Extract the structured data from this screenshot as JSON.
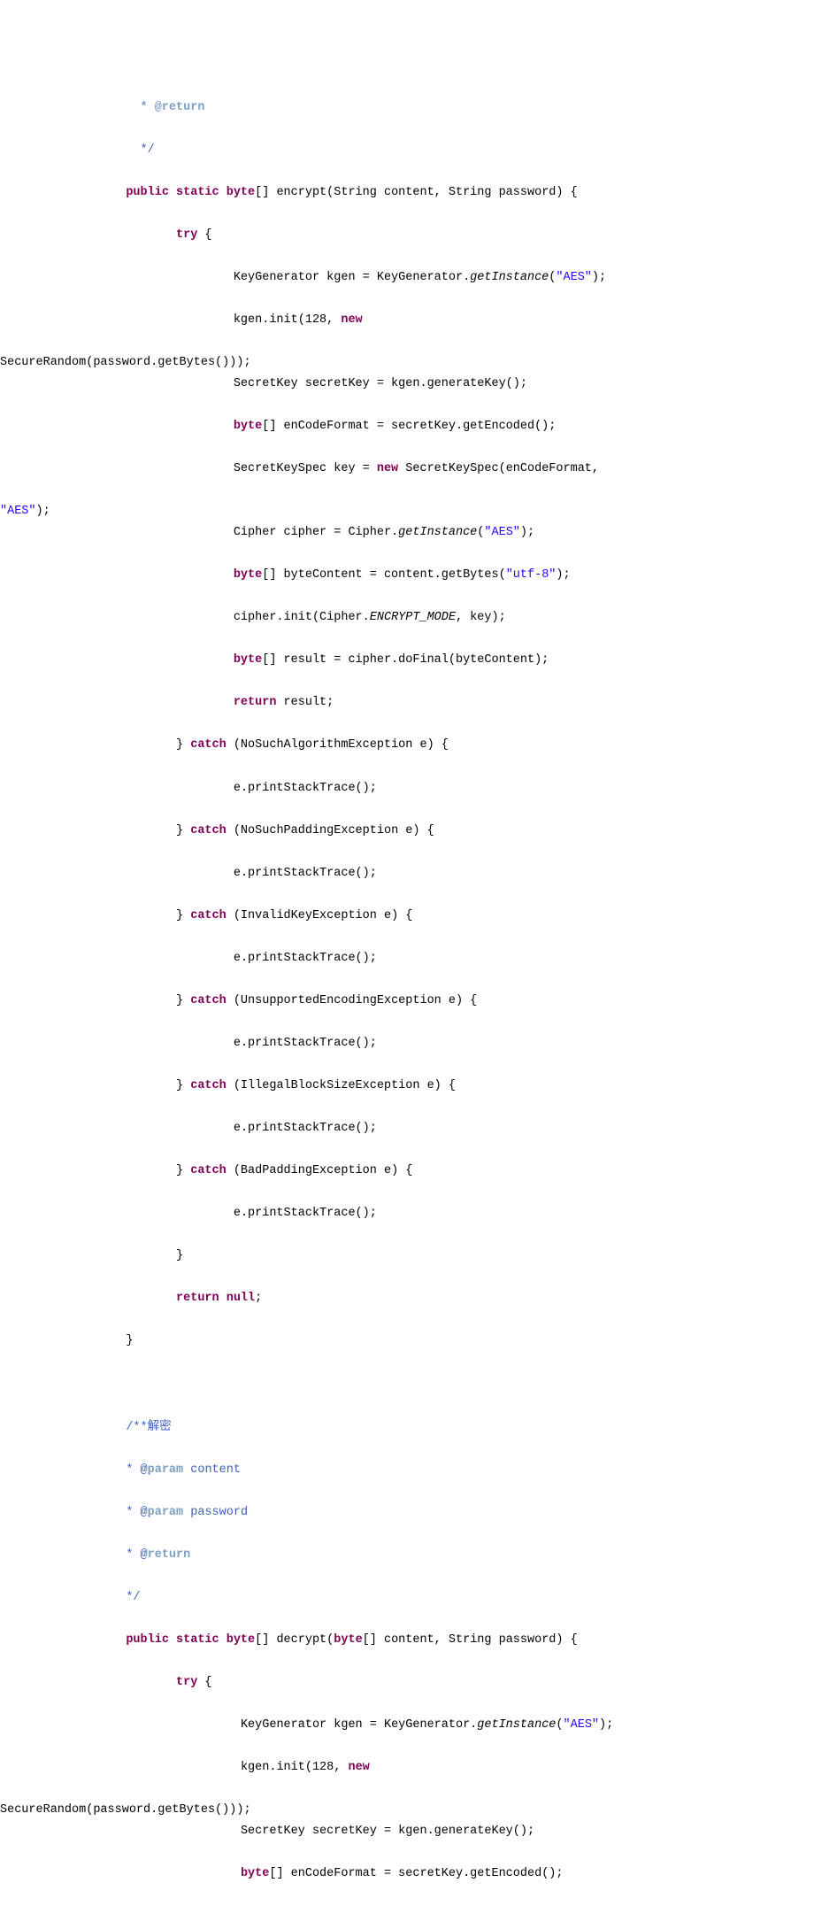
{
  "lines": {
    "l01": " * @return",
    "l02": " */",
    "l03_a": "public static byte",
    "l03_b": "[] encrypt(String content, String password) {",
    "l04": "try",
    "l04_b": " {",
    "l05_a": "KeyGenerator kgen = KeyGenerator.",
    "l05_b": "getInstance",
    "l05_c": "(",
    "l05_d": "\"AES\"",
    "l05_e": ");",
    "l06_a": "kgen.init(128, ",
    "l06_b": "new",
    "l07": "SecureRandom(password.getBytes()));",
    "l08": "SecretKey secretKey = kgen.generateKey();",
    "l09_a": "byte",
    "l09_b": "[] enCodeFormat = secretKey.getEncoded();",
    "l10_a": "SecretKeySpec key = ",
    "l10_b": "new",
    "l10_c": " SecretKeySpec(enCodeFormat, ",
    "l11": "\"AES\"",
    "l11_b": ");",
    "l12_a": "Cipher cipher = Cipher.",
    "l12_b": "getInstance",
    "l12_c": "(",
    "l12_d": "\"AES\"",
    "l12_e": ");",
    "l13_a": "byte",
    "l13_b": "[] byteContent = content.getBytes(",
    "l13_c": "\"utf-8\"",
    "l13_d": ");",
    "l14_a": "cipher.init(Cipher.",
    "l14_b": "ENCRYPT_MODE",
    "l14_c": ", key);",
    "l15_a": "byte",
    "l15_b": "[] result = cipher.doFinal(byteContent);",
    "l16_a": "return",
    "l16_b": " result;",
    "l17_a": "} ",
    "l17_b": "catch",
    "l17_c": " (NoSuchAlgorithmException e) {",
    "l18": "e.printStackTrace();",
    "l19_a": "} ",
    "l19_b": "catch",
    "l19_c": " (NoSuchPaddingException e) {",
    "l20": "e.printStackTrace();",
    "l21_a": "} ",
    "l21_b": "catch",
    "l21_c": " (InvalidKeyException e) {",
    "l22": "e.printStackTrace();",
    "l23_a": "} ",
    "l23_b": "catch",
    "l23_c": " (UnsupportedEncodingException e) {",
    "l24": "e.printStackTrace();",
    "l25_a": "} ",
    "l25_b": "catch",
    "l25_c": " (IllegalBlockSizeException e) {",
    "l26": "e.printStackTrace();",
    "l27_a": "} ",
    "l27_b": "catch",
    "l27_c": " (BadPaddingException e) {",
    "l28": "e.printStackTrace();",
    "l29": "}",
    "l30_a": "return null",
    "l30_b": ";",
    "l31": "}",
    "l32_a": "/**",
    "l32_b": "解密",
    "l33_a": "* @",
    "l33_b": "param",
    "l33_c": " content",
    "l34_a": "* @",
    "l34_b": "param",
    "l34_c": " password",
    "l35_a": "* @",
    "l35_b": "return",
    "l36": "*/",
    "l37_a": "public static byte",
    "l37_b": "[] decrypt(",
    "l37_c": "byte",
    "l37_d": "[] content, String password) {",
    "l38_a": "try",
    "l38_b": " {",
    "l39_a": "KeyGenerator kgen = KeyGenerator.",
    "l39_b": "getInstance",
    "l39_c": "(",
    "l39_d": "\"AES\"",
    "l39_e": ");",
    "l40_a": "kgen.init(128, ",
    "l40_b": "new",
    "l41": "SecureRandom(password.getBytes()));",
    "l42": "SecretKey secretKey = kgen.generateKey();",
    "l43_a": "byte",
    "l43_b": "[] enCodeFormat = secretKey.getEncoded();"
  }
}
